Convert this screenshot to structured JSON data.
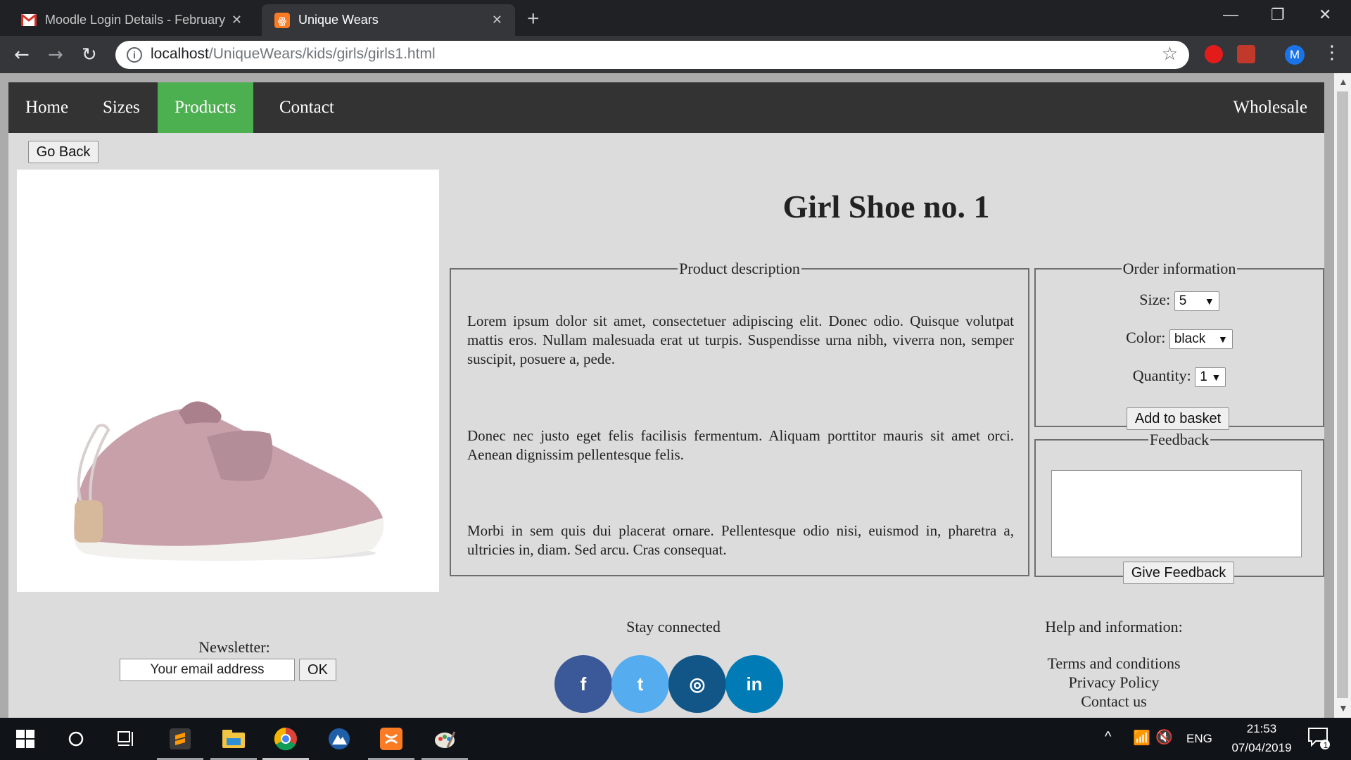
{
  "browser": {
    "tabs": [
      {
        "title": "Moodle Login Details - February",
        "icon": "gmail-icon"
      },
      {
        "title": "Unique Wears",
        "icon": "xampp-icon"
      }
    ],
    "url_host": "localhost",
    "url_path": "/UniqueWears/kids/girls/girls1.html",
    "profile_initial": "M"
  },
  "nav": {
    "items": [
      "Home",
      "Sizes",
      "Products",
      "Contact"
    ],
    "active": "Products",
    "right_item": "Wholesale",
    "active_color": "#4caf50"
  },
  "page": {
    "go_back_label": "Go Back",
    "product_title": "Girl Shoe no. 1",
    "description": {
      "legend": "Product description",
      "paragraphs": [
        "Lorem ipsum dolor sit amet, consectetuer adipiscing elit. Donec odio. Quisque volutpat mattis eros. Nullam malesuada erat ut turpis. Suspendisse urna nibh, viverra non, semper suscipit, posuere a, pede.",
        "Donec nec justo eget felis facilisis fermentum. Aliquam porttitor mauris sit amet orci. Aenean dignissim pellentesque felis.",
        "Morbi in sem quis dui placerat ornare. Pellentesque odio nisi, euismod in, pharetra a, ultricies in, diam. Sed arcu. Cras consequat."
      ]
    },
    "order": {
      "legend": "Order information",
      "size_label": "Size:",
      "size_value": "5",
      "color_label": "Color:",
      "color_value": "black",
      "quantity_label": "Quantity:",
      "quantity_value": "1",
      "add_button": "Add to basket"
    },
    "feedback": {
      "legend": "Feedback",
      "text": "",
      "button": "Give Feedback"
    }
  },
  "footer": {
    "newsletter_label": "Newsletter:",
    "email_placeholder": "Your email address",
    "ok_label": "OK",
    "stay_connected": "Stay connected",
    "social": [
      {
        "name": "facebook",
        "glyph": "f",
        "color": "#3b5998"
      },
      {
        "name": "twitter",
        "glyph": "t",
        "color": "#55acee"
      },
      {
        "name": "instagram",
        "glyph": "◎",
        "color": "#125688"
      },
      {
        "name": "linkedin",
        "glyph": "in",
        "color": "#007bb5"
      }
    ],
    "help_title": "Help and information:",
    "help_links": [
      "Terms and conditions",
      "Privacy Policy",
      "Contact us"
    ]
  },
  "taskbar": {
    "language": "ENG",
    "time": "21:53",
    "date": "07/04/2019",
    "notification_count": "1"
  }
}
